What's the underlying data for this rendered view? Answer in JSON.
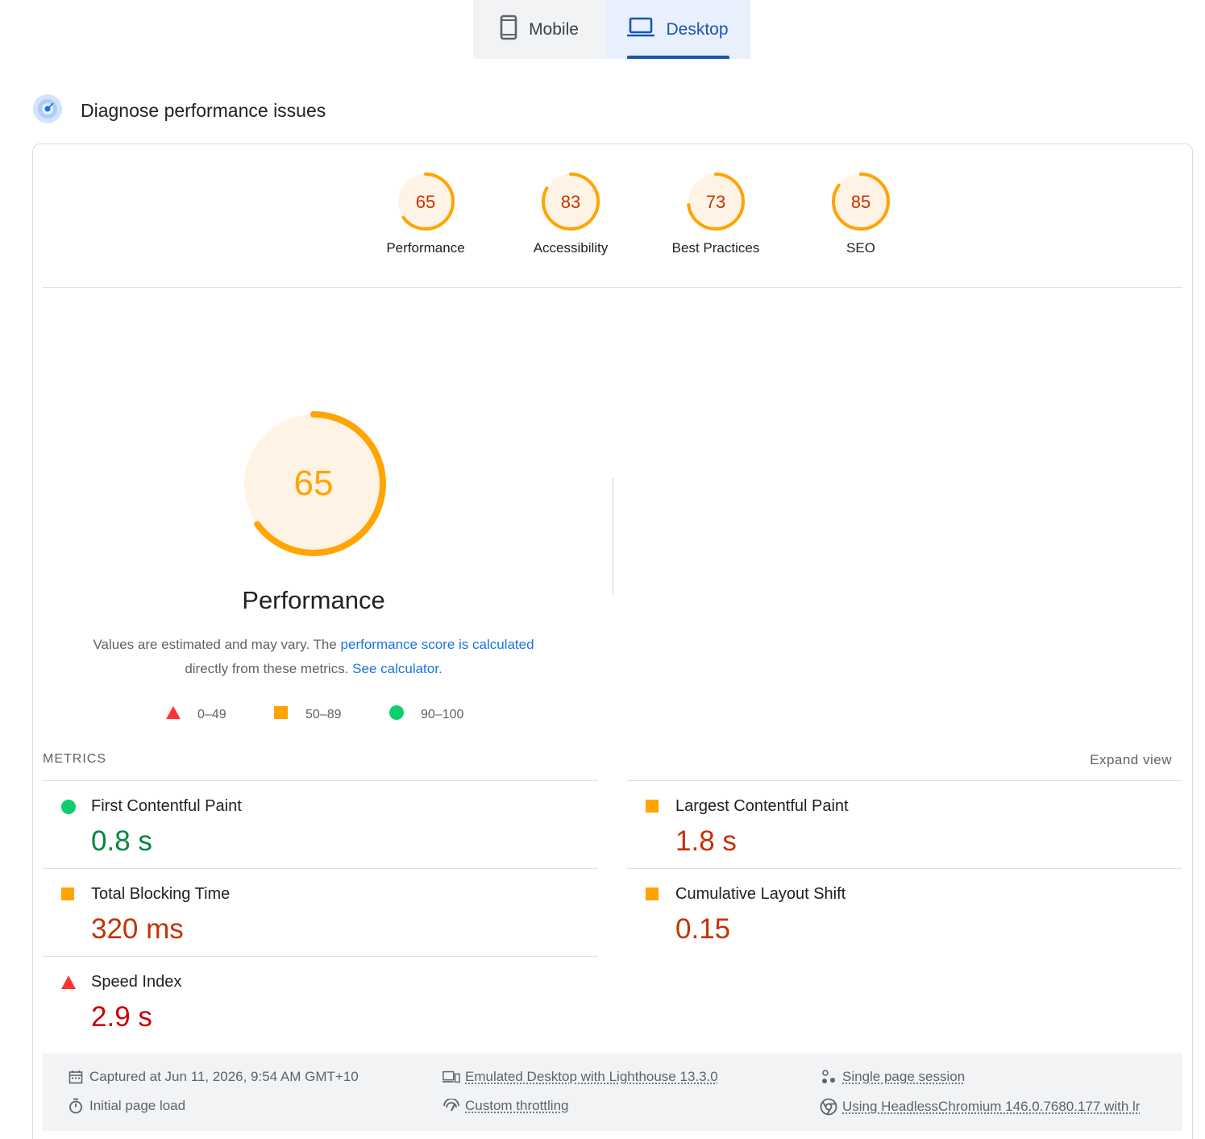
{
  "tabs": {
    "mobile": {
      "label": "Mobile",
      "icon": "mobile-phone-icon"
    },
    "desktop": {
      "label": "Desktop",
      "icon": "laptop-icon",
      "selected": true
    }
  },
  "section": {
    "title": "Diagnose performance issues",
    "icon": "diagnose-radar-icon"
  },
  "categories": [
    {
      "score": "65",
      "label": "Performance"
    },
    {
      "score": "83",
      "label": "Accessibility"
    },
    {
      "score": "73",
      "label": "Best Practices"
    },
    {
      "score": "85",
      "label": "SEO"
    }
  ],
  "performance": {
    "score": "65",
    "title": "Performance",
    "desc_prefix": "Values are estimated and may vary. The ",
    "desc_link1": "performance score is calculated",
    "desc_middle": "directly from these metrics.",
    "desc_link2": "See calculator."
  },
  "legend": {
    "fail": "0–49",
    "average": "50–89",
    "pass": "90–100"
  },
  "metrics": {
    "header": "METRICS",
    "expand_label": "Expand view",
    "items": [
      {
        "name": "First Contentful Paint",
        "value": "0.8 s",
        "rating": "pass"
      },
      {
        "name": "Largest Contentful Paint",
        "value": "1.8 s",
        "rating": "average"
      },
      {
        "name": "Total Blocking Time",
        "value": "320 ms",
        "rating": "average"
      },
      {
        "name": "Cumulative Layout Shift",
        "value": "0.15",
        "rating": "average"
      },
      {
        "name": "Speed Index",
        "value": "2.9 s",
        "rating": "fail"
      }
    ]
  },
  "footer": {
    "captured": "Captured at Jun 11, 2026, 9:54 AM GMT+10",
    "emulated": "Emulated Desktop with Lighthouse 13.3.0",
    "session": "Single page session",
    "load": "Initial page load",
    "throttling": "Custom throttling",
    "browser": "Using HeadlessChromium 146.0.7680.177 with lr"
  },
  "colors": {
    "accent": "#1a56b0",
    "link": "#1a73e8",
    "average": "#ffa400",
    "average_text": "#c33300",
    "pass": "#0cce6b",
    "pass_text": "#018642",
    "fail": "#ff3333",
    "fail_text": "#cc0000"
  }
}
